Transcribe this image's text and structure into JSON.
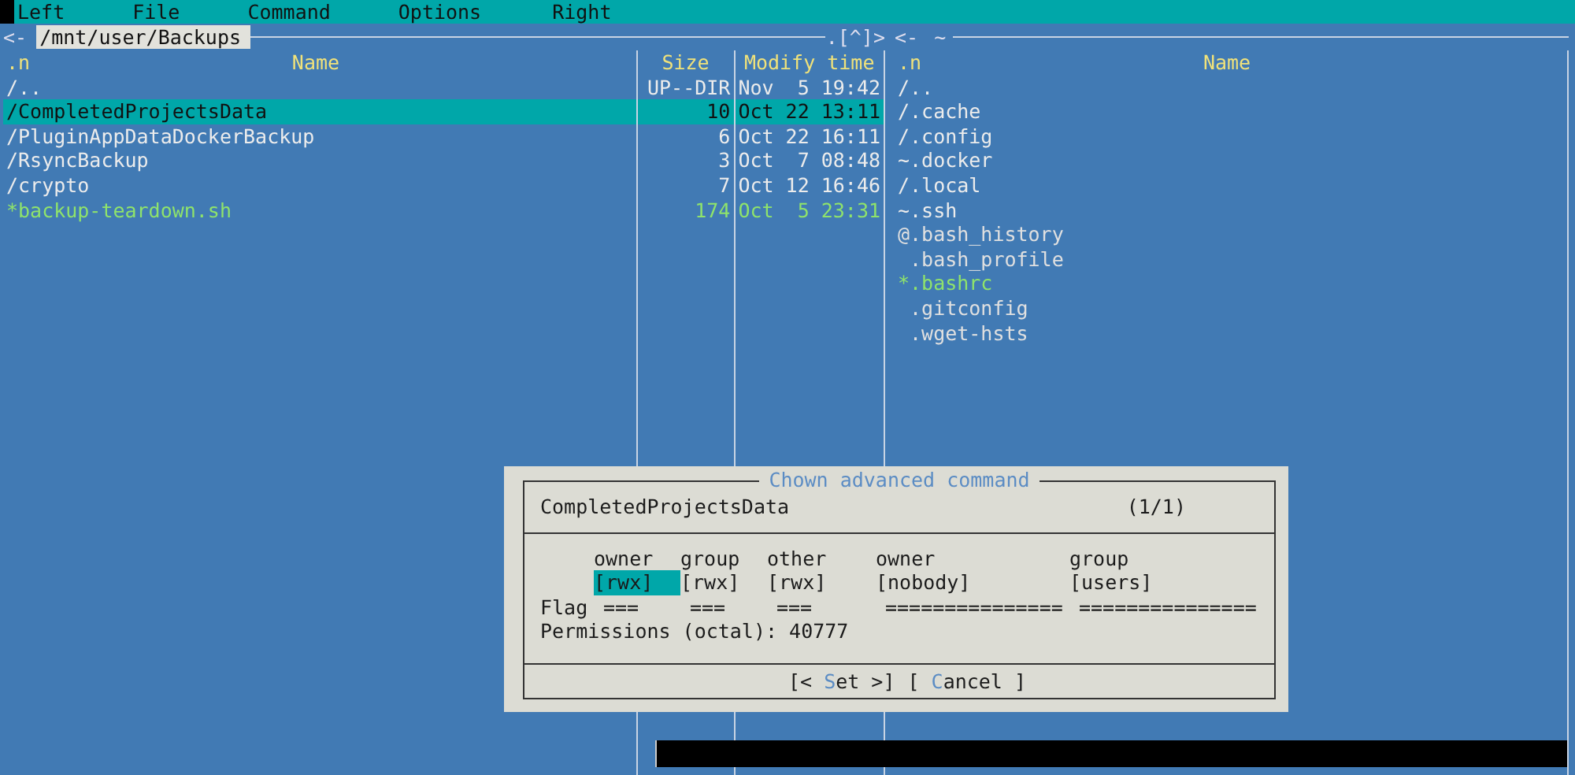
{
  "menu_bar": {
    "items": [
      {
        "label": "Left"
      },
      {
        "label": "File"
      },
      {
        "label": "Command"
      },
      {
        "label": "Options"
      },
      {
        "label": "Right"
      }
    ]
  },
  "left_panel": {
    "nav": "<-",
    "path": "/mnt/user/Backups",
    "corner": ".[^]>",
    "columns": [
      ".n",
      "Name",
      "Size",
      "Modify time"
    ],
    "rows": [
      {
        "name": "/..",
        "size": "UP--DIR",
        "modified": "Nov  5 19:42",
        "kind": "dir",
        "selected": false
      },
      {
        "name": "/CompletedProjectsData",
        "size": "10",
        "modified": "Oct 22 13:11",
        "kind": "dir",
        "selected": true
      },
      {
        "name": "/PluginAppDataDockerBackup",
        "size": "6",
        "modified": "Oct 22 16:11",
        "kind": "dir",
        "selected": false
      },
      {
        "name": "/RsyncBackup",
        "size": "3",
        "modified": "Oct  7 08:48",
        "kind": "dir",
        "selected": false
      },
      {
        "name": "/crypto",
        "size": "7",
        "modified": "Oct 12 16:46",
        "kind": "dir",
        "selected": false
      },
      {
        "name": "*backup-teardown.sh",
        "size": "174",
        "modified": "Oct  5 23:31",
        "kind": "exec",
        "selected": false
      }
    ]
  },
  "right_panel": {
    "nav": "<-",
    "path": "~",
    "columns": [
      ".n",
      "Name"
    ],
    "rows": [
      {
        "name": "/..",
        "kind": "dir"
      },
      {
        "name": "/.cache",
        "kind": "dir"
      },
      {
        "name": "/.config",
        "kind": "dir"
      },
      {
        "name": "~.docker",
        "kind": "dir"
      },
      {
        "name": "/.local",
        "kind": "dir"
      },
      {
        "name": "~.ssh",
        "kind": "dir"
      },
      {
        "name": "@.bash_history",
        "kind": "file"
      },
      {
        "name": " .bash_profile",
        "kind": "file"
      },
      {
        "name": "*.bashrc",
        "kind": "exec"
      },
      {
        "name": " .gitconfig",
        "kind": "file"
      },
      {
        "name": " .wget-hsts",
        "kind": "file"
      }
    ]
  },
  "dialog": {
    "title": "Chown advanced command",
    "file_name": "CompletedProjectsData",
    "counter": "(1/1)",
    "flag_label": "Flag",
    "fields": [
      {
        "header": "owner",
        "value": "[rwx]",
        "flag": "===",
        "selected": true
      },
      {
        "header": "group",
        "value": "[rwx]",
        "flag": "===",
        "selected": false
      },
      {
        "header": "other",
        "value": "[rwx]",
        "flag": "===",
        "selected": false
      },
      {
        "header": "owner",
        "value": "[nobody]",
        "flag": "===============",
        "selected": false
      },
      {
        "header": "group",
        "value": "[users]",
        "flag": "===============",
        "selected": false
      }
    ],
    "permissions_label": "Permissions (octal):",
    "permissions_value": "40777",
    "buttons": [
      {
        "prefix": "[< ",
        "hotkey": "S",
        "suffix": "et >]"
      },
      {
        "prefix": "[ ",
        "hotkey": "C",
        "suffix": "ancel ]"
      }
    ]
  }
}
